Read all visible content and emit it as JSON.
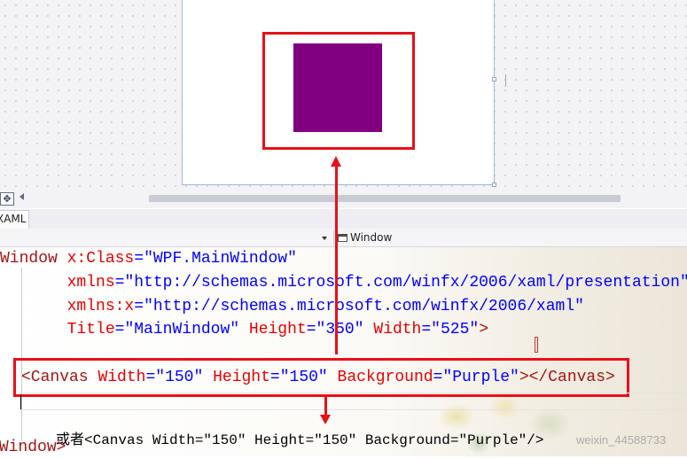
{
  "designer": {
    "canvas_color": "#800080",
    "highlight_color": "#e8101a"
  },
  "toolbar": {
    "pan_icon": "move-icon"
  },
  "tabs": [
    {
      "label": "XAML"
    }
  ],
  "navbar": {
    "right_label": "Window"
  },
  "code": {
    "line1": {
      "tag": "Window",
      "attr1": "x:Class",
      "eq": "=",
      "val1": "\"WPF.MainWindow\""
    },
    "line2": {
      "attr": "xmlns",
      "eq": "=",
      "val": "\"http://schemas.microsoft.com/winfx/2006/xaml/presentation\""
    },
    "line3": {
      "attr": "xmlns:x",
      "eq": "=",
      "val": "\"http://schemas.microsoft.com/winfx/2006/xaml\""
    },
    "line4": {
      "attr1": "Title",
      "val1": "\"MainWindow\"",
      "attr2": "Height",
      "val2": "\"350\"",
      "attr3": "Width",
      "val3": "\"525\"",
      "close": ">"
    },
    "line5": {
      "open": "<Canvas",
      "attr1": "Width",
      "val1": "\"150\"",
      "attr2": "Height",
      "val2": "\"150\"",
      "attr3": "Background",
      "val3": "\"Purple\"",
      "close": "></Canvas>"
    },
    "line7": "或者<Canvas Width=\"150\" Height=\"150\" Background=\"Purple\"/>",
    "line8": "Window>"
  },
  "watermark": "weixin_44588733"
}
